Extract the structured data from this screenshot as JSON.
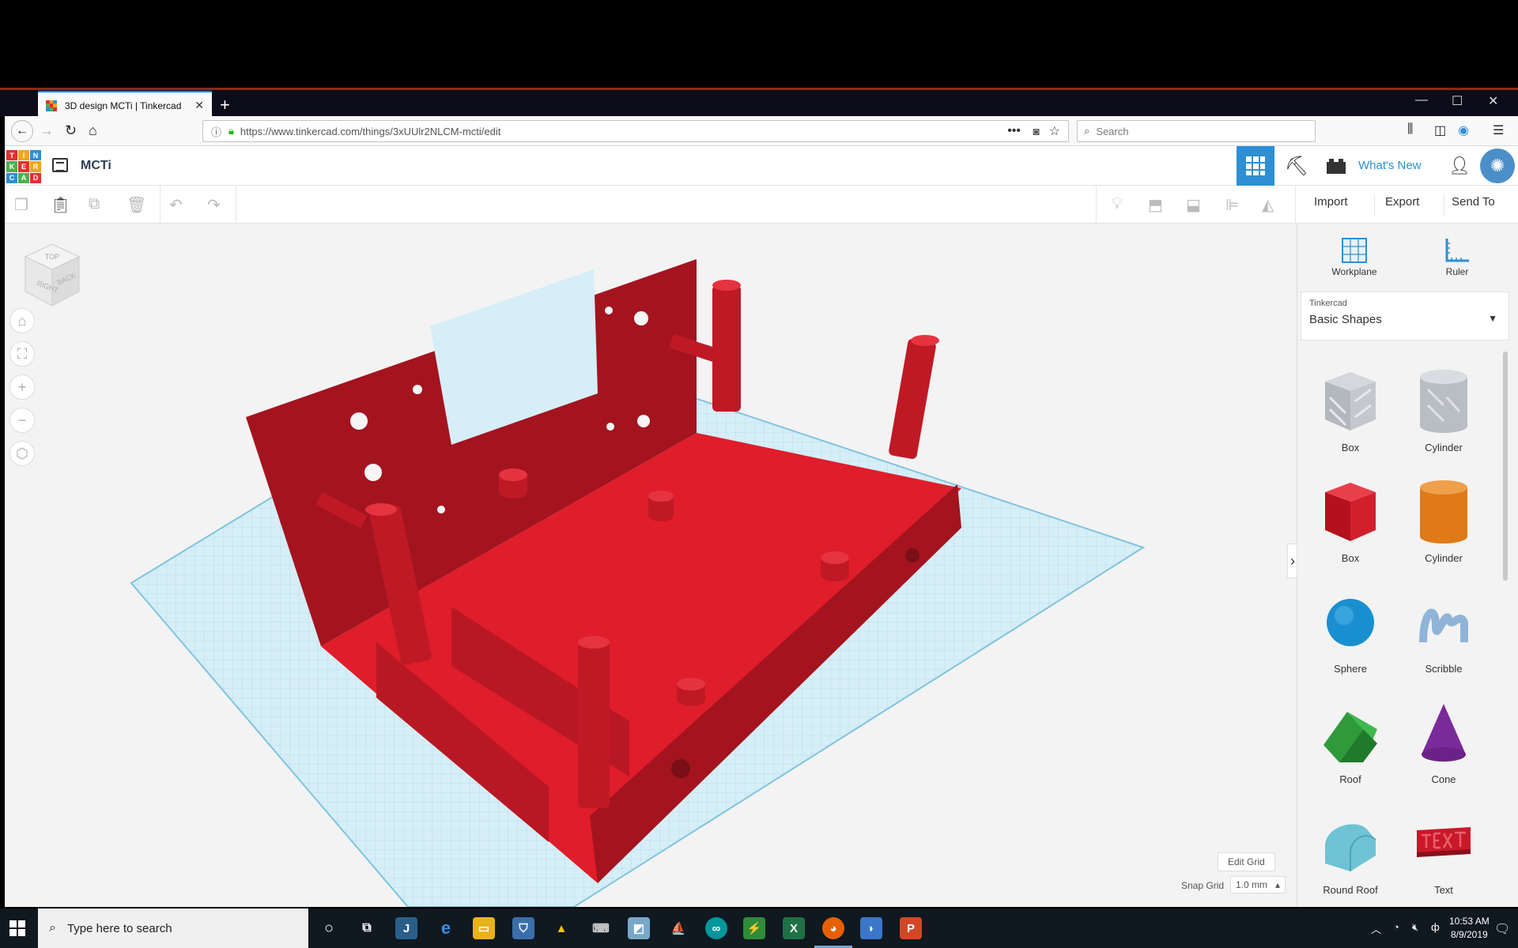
{
  "browser": {
    "tab_title": "3D design MCTi | Tinkercad",
    "url": "https://www.tinkercad.com/things/3xUUlr2NLCM-mcti/edit",
    "search_placeholder": "Search"
  },
  "header": {
    "design_name": "MCTi",
    "logo_letters": [
      "T",
      "I",
      "N",
      "K",
      "E",
      "R",
      "C",
      "A",
      "D"
    ],
    "whats_new": "What's New"
  },
  "toolbar": {
    "import": "Import",
    "export": "Export",
    "send_to": "Send To"
  },
  "viewcube": {
    "top": "TOP",
    "right": "RIGHT",
    "back": "BACK"
  },
  "workplane_label": "Workplane",
  "viewport": {
    "edit_grid": "Edit Grid",
    "snap_grid_label": "Snap Grid",
    "snap_grid_value": "1.0 mm"
  },
  "panel": {
    "tools": [
      {
        "label": "Workplane"
      },
      {
        "label": "Ruler"
      }
    ],
    "library_source": "Tinkercad",
    "library_name": "Basic Shapes",
    "shapes": [
      {
        "label": "Box",
        "color": "#b8bcc4"
      },
      {
        "label": "Cylinder",
        "color": "#b8bcc4"
      },
      {
        "label": "Box",
        "color": "#d92231"
      },
      {
        "label": "Cylinder",
        "color": "#e8801a"
      },
      {
        "label": "Sphere",
        "color": "#1a8fd0"
      },
      {
        "label": "Scribble",
        "color": "#8fb4d8"
      },
      {
        "label": "Roof",
        "color": "#2e9a3a"
      },
      {
        "label": "Cone",
        "color": "#7a2b9a"
      },
      {
        "label": "Round Roof",
        "color": "#6fc3d4"
      },
      {
        "label": "Text",
        "color": "#c8192a"
      }
    ]
  },
  "taskbar": {
    "search_placeholder": "Type here to search",
    "time": "10:53 AM",
    "date": "8/9/2019"
  },
  "colors": {
    "accent": "#2e8fd4",
    "model_red": "#d81f2c",
    "grid_blue": "#bfe3f0"
  }
}
